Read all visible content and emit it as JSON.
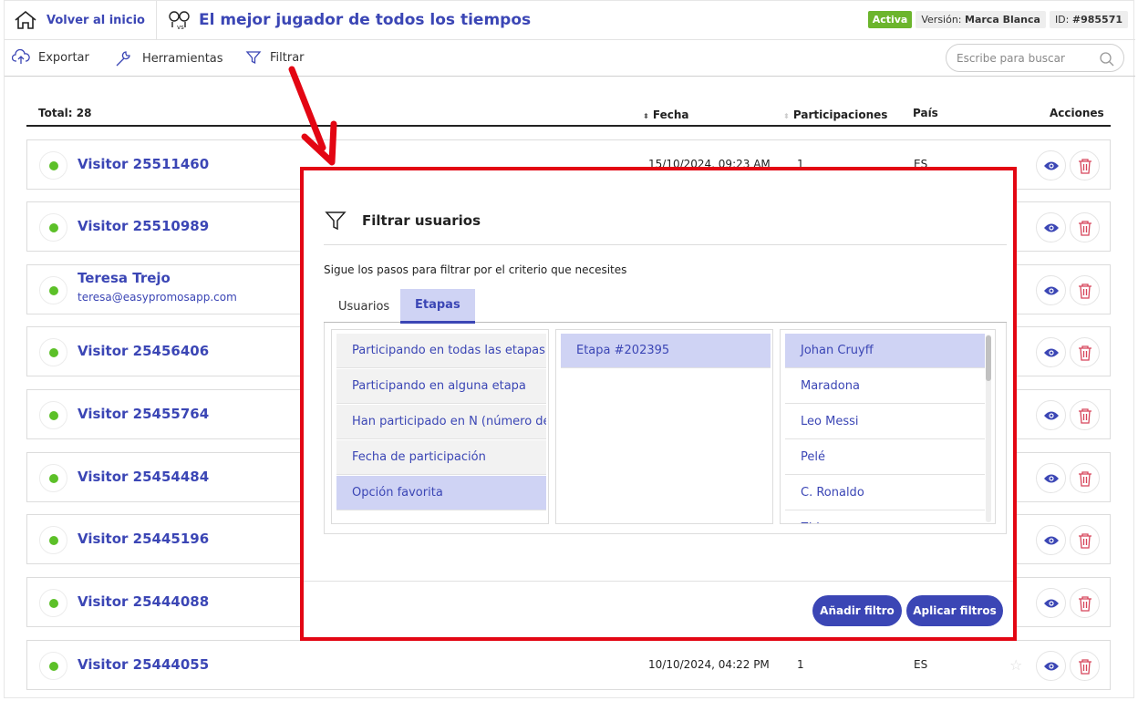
{
  "header": {
    "home_label": "Volver al inicio",
    "promo_title": "El mejor jugador de todos los tiempos",
    "status": "Activa",
    "version_label": "Versión:",
    "version_value": "Marca Blanca",
    "id_label": "ID:",
    "id_value": "#985571"
  },
  "toolbar": {
    "export_label": "Exportar",
    "tools_label": "Herramientas",
    "filter_label": "Filtrar",
    "search_placeholder": "Escribe para buscar"
  },
  "table": {
    "total": "Total: 28",
    "col_date": "Fecha",
    "col_participations": "Participaciones",
    "col_country": "País",
    "col_actions": "Acciones",
    "rows": [
      {
        "name": "Visitor 25511460",
        "email": "",
        "date": "15/10/2024, 09:23 AM",
        "participations": "1",
        "country": "ES"
      },
      {
        "name": "Visitor 25510989",
        "email": "",
        "date": "",
        "participations": "",
        "country": ""
      },
      {
        "name": "Teresa Trejo",
        "email": "teresa@easypromosapp.com",
        "date": "",
        "participations": "",
        "country": ""
      },
      {
        "name": "Visitor 25456406",
        "email": "",
        "date": "",
        "participations": "",
        "country": ""
      },
      {
        "name": "Visitor 25455764",
        "email": "",
        "date": "",
        "participations": "",
        "country": ""
      },
      {
        "name": "Visitor 25454484",
        "email": "",
        "date": "",
        "participations": "",
        "country": ""
      },
      {
        "name": "Visitor 25445196",
        "email": "",
        "date": "",
        "participations": "",
        "country": ""
      },
      {
        "name": "Visitor 25444088",
        "email": "",
        "date": "",
        "participations": "",
        "country": ""
      },
      {
        "name": "Visitor 25444055",
        "email": "",
        "date": "10/10/2024, 04:22 PM",
        "participations": "1",
        "country": "ES"
      }
    ]
  },
  "modal": {
    "title": "Filtrar usuarios",
    "description": "Sigue los pasos para filtrar por el criterio que necesites",
    "tabs": [
      "Usuarios",
      "Etapas"
    ],
    "criteria": [
      "Participando en todas las etapas",
      "Participando en alguna etapa",
      "Han participado en N (número de",
      "Fecha de participación",
      "Opción favorita"
    ],
    "stages": [
      "Etapa #202395"
    ],
    "options": [
      "Johan Cruyff",
      "Maradona",
      "Leo Messi",
      "Pelé",
      "C. Ronaldo",
      "Zidane"
    ],
    "add_filter": "Añadir filtro",
    "apply_filters": "Aplicar filtros"
  },
  "colors": {
    "accent": "#3b46b5",
    "active_badge": "#6cb52d",
    "annotation": "#e30613",
    "status_dot": "#5cc028",
    "delete": "#d6455a"
  }
}
